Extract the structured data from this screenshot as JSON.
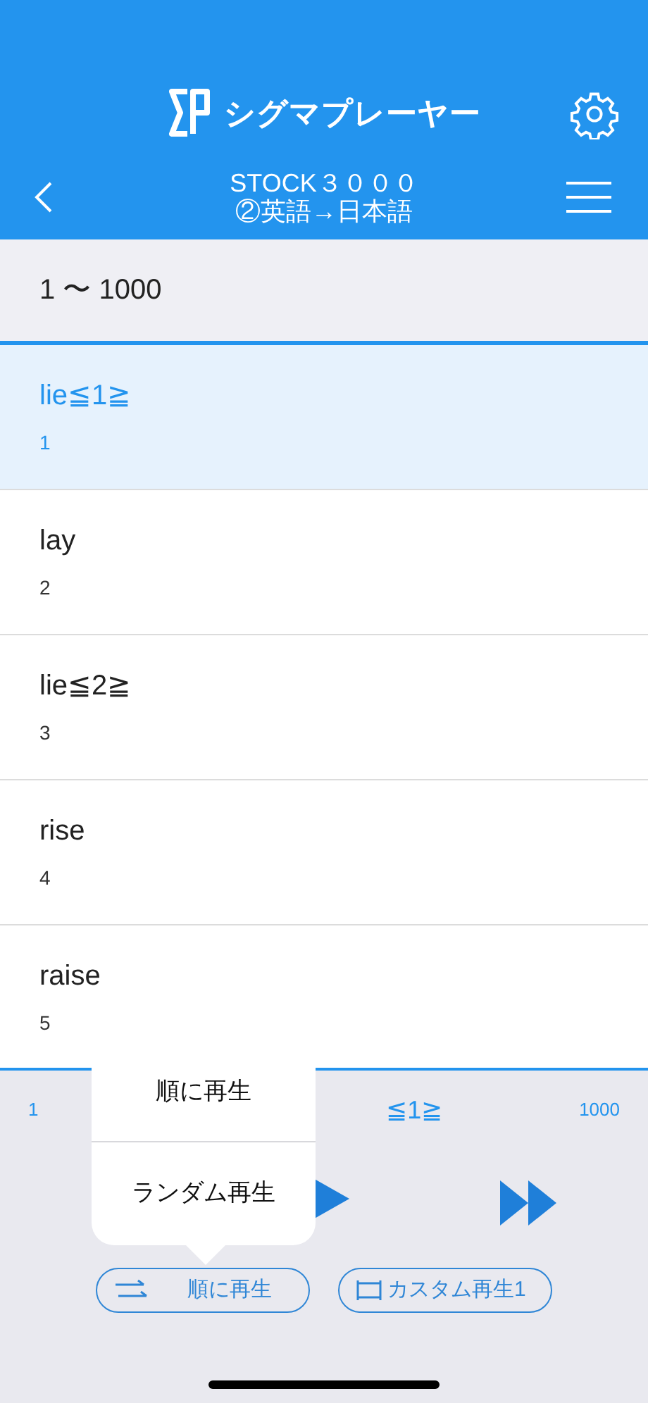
{
  "header": {
    "app_title": "シグマプレーヤー",
    "title": "STOCK３０００",
    "subtitle": "②英語→日本語"
  },
  "section": {
    "label": "1 〜 1000"
  },
  "words": [
    {
      "word": "lie≦1≧",
      "number": "1",
      "selected": true
    },
    {
      "word": "lay",
      "number": "2",
      "selected": false
    },
    {
      "word": "lie≦2≧",
      "number": "3",
      "selected": false
    },
    {
      "word": "rise",
      "number": "4",
      "selected": false
    },
    {
      "word": "raise",
      "number": "5",
      "selected": false
    }
  ],
  "player": {
    "start": "1",
    "current": "≦1≧",
    "end": "1000"
  },
  "mode_buttons": [
    {
      "label": "順に再生",
      "kind": "order"
    },
    {
      "label": "カスタム再生1",
      "kind": "custom"
    }
  ],
  "popover": {
    "options": [
      "順に再生",
      "ランダム再生"
    ]
  }
}
